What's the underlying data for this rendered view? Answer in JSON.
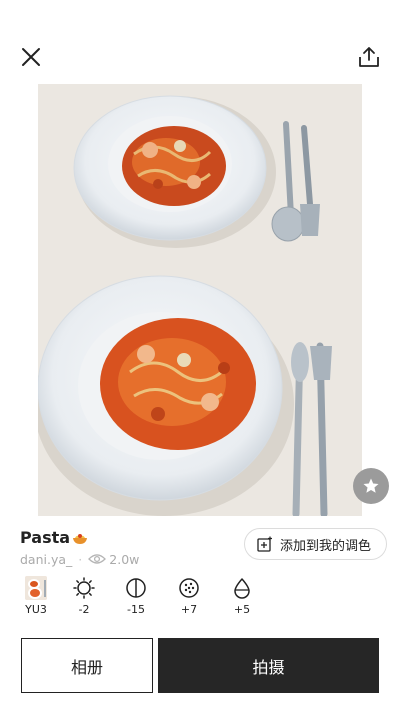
{
  "recipe": {
    "title": "Pasta",
    "author": "dani.ya_",
    "views": "2.0w"
  },
  "actions": {
    "add_label": "添加到我的调色",
    "album_label": "相册",
    "shoot_label": "拍摄"
  },
  "adjustments": [
    {
      "icon": "filter-thumbnail",
      "label": "YU3"
    },
    {
      "icon": "brightness-icon",
      "label": "-2"
    },
    {
      "icon": "contrast-icon",
      "label": "-15"
    },
    {
      "icon": "grain-icon",
      "label": "+7"
    },
    {
      "icon": "saturation-icon",
      "label": "+5"
    }
  ],
  "colors": {
    "dark_button": "#262626",
    "favorite_bg": "#9b9b9b",
    "muted_text": "#aaaaaa"
  }
}
